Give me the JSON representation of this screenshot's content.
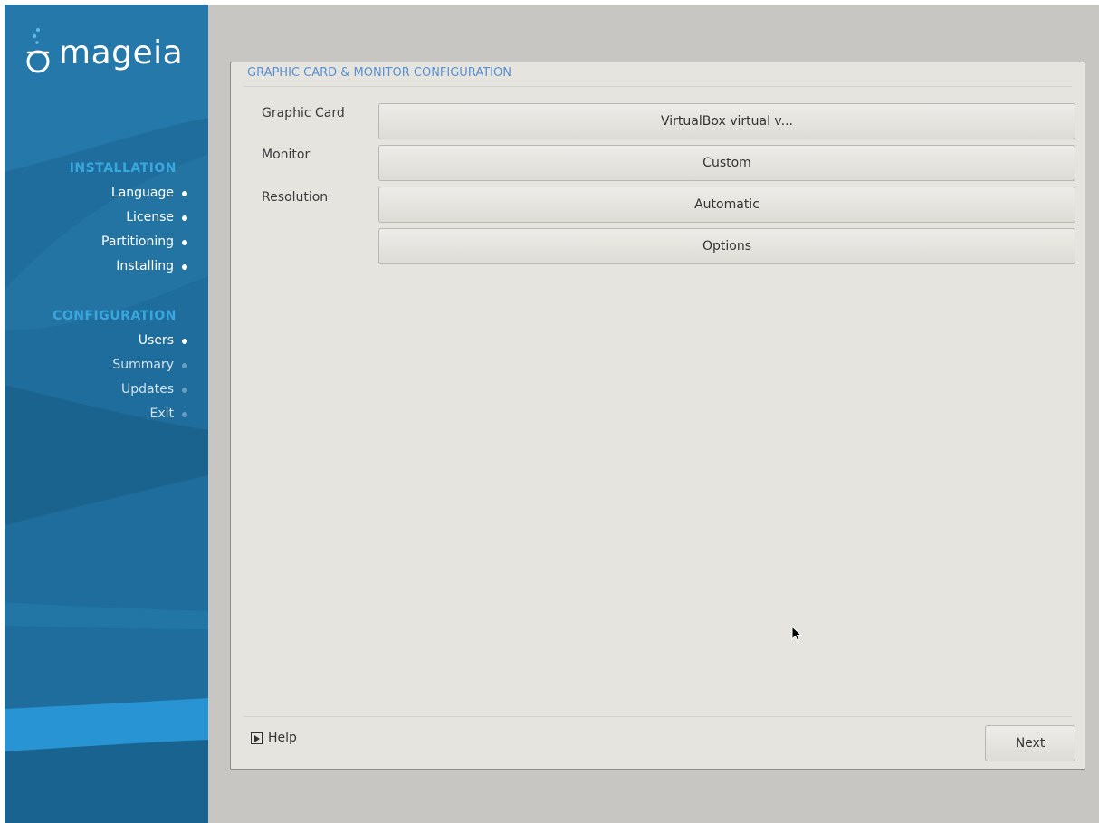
{
  "brand": {
    "name": "mageia"
  },
  "sidebar": {
    "sections": [
      {
        "title": "INSTALLATION",
        "items": [
          {
            "label": "Language",
            "state": "done"
          },
          {
            "label": "License",
            "state": "done"
          },
          {
            "label": "Partitioning",
            "state": "done"
          },
          {
            "label": "Installing",
            "state": "done"
          }
        ]
      },
      {
        "title": "CONFIGURATION",
        "items": [
          {
            "label": "Users",
            "state": "done"
          },
          {
            "label": "Summary",
            "state": "pending"
          },
          {
            "label": "Updates",
            "state": "pending"
          },
          {
            "label": "Exit",
            "state": "pending"
          }
        ]
      }
    ]
  },
  "panel": {
    "title": "GRAPHIC CARD & MONITOR CONFIGURATION",
    "fields": [
      {
        "label": "Graphic Card",
        "value": "VirtualBox virtual v..."
      },
      {
        "label": "Monitor",
        "value": "Custom"
      },
      {
        "label": "Resolution",
        "value": "Automatic"
      }
    ],
    "options_label": "Options"
  },
  "footer": {
    "help_label": "Help",
    "next_label": "Next"
  },
  "colors": {
    "sidebar": "#1e6d9c",
    "accent": "#3aa6de",
    "panel": "#e5e4df",
    "title": "#5b8fd0"
  }
}
